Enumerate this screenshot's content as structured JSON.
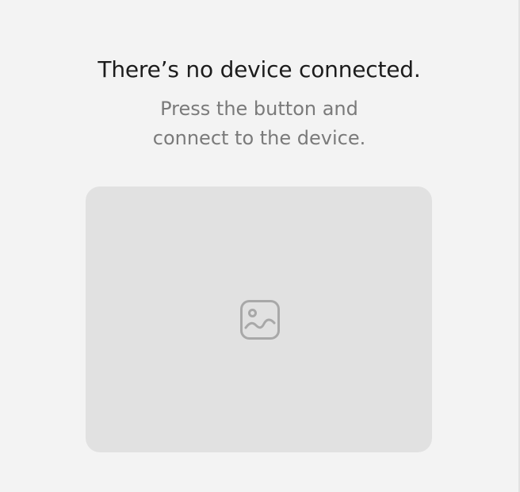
{
  "empty_state": {
    "title": "There’s no device connected.",
    "subtitle_line1": "Press the button and",
    "subtitle_line2": "connect to the device.",
    "placeholder_icon": "image-placeholder-icon"
  },
  "colors": {
    "background": "#f3f3f3",
    "title": "#1c1c1c",
    "subtitle": "#7a7a7a",
    "placeholder_bg": "#e1e1e1",
    "icon": "#a8a8a8"
  }
}
